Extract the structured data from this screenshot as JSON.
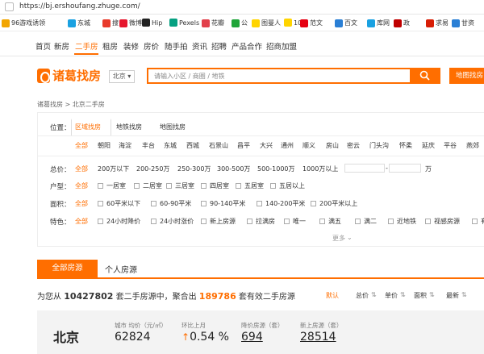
{
  "address": {
    "url": "https://bj.ershoufang.zhuge.com/"
  },
  "bookmarks": [
    {
      "label": "96游戏诱领",
      "color": "#f2a500"
    },
    {
      "label": "东城",
      "color": "#1aa1e1"
    },
    {
      "label": "搜",
      "color": "#e83a2b"
    },
    {
      "label": "微博",
      "color": "#e6162d"
    },
    {
      "label": "Hip",
      "color": "#222222"
    },
    {
      "label": "Pexels",
      "color": "#05a081"
    },
    {
      "label": "花瓣",
      "color": "#e2404b"
    },
    {
      "label": "公",
      "color": "#20a53a"
    },
    {
      "label": "图曼人",
      "color": "#ffd400"
    },
    {
      "label": "100",
      "color": "#ffd400"
    },
    {
      "label": "范文",
      "color": "#e60012"
    },
    {
      "label": "百文",
      "color": "#2a7fd5"
    },
    {
      "label": "库网",
      "color": "#1aa1e1"
    },
    {
      "label": "政",
      "color": "#c00000"
    },
    {
      "label": "求易",
      "color": "#d81e06"
    },
    {
      "label": "甘资",
      "color": "#2a7fd5"
    }
  ],
  "nav": [
    "首页",
    "新房",
    "二手房",
    "租房",
    "装修",
    "房价",
    "随手拍",
    "资讯",
    "招聘",
    "产品合作",
    "招商加盟"
  ],
  "header": {
    "logo": "诸葛找房",
    "city": "北京",
    "search_placeholder": "请输入小区 / 商圈 / 地铁",
    "map_button": "地图找房"
  },
  "breadcrumb": "诸葛找房 > 北京二手房",
  "filters": {
    "position_label": "位置：",
    "position_tabs": [
      "区域找房",
      "地铁找房",
      "地图找房"
    ],
    "areas": [
      "全部",
      "朝阳",
      "海淀",
      "丰台",
      "东城",
      "西城",
      "石景山",
      "昌平",
      "大兴",
      "通州",
      "顺义",
      "房山",
      "密云",
      "门头沟",
      "怀柔",
      "延庆",
      "平谷",
      "燕郊"
    ],
    "price_label": "总价：",
    "prices": [
      "全部",
      "200万以下",
      "200-250万",
      "250-300万",
      "300-500万",
      "500-1000万",
      "1000万以上"
    ],
    "price_unit": "万",
    "layout_label": "户型：",
    "layouts": [
      "全部",
      "一居室",
      "二居室",
      "三居室",
      "四居室",
      "五居室",
      "五居以上"
    ],
    "area_label": "面积：",
    "sizes": [
      "全部",
      "60平米以下",
      "60-90平米",
      "90-140平米",
      "140-200平米",
      "200平米以上"
    ],
    "feature_label": "特色：",
    "features": [
      "全部",
      "24小时降价",
      "24小时涨价",
      "新上房源",
      "拉满房",
      "唯一",
      "满五",
      "满二",
      "近地铁",
      "视感房源",
      "有"
    ],
    "more": "更多"
  },
  "tabs": {
    "all": "全部房源",
    "personal": "个人房源"
  },
  "summary": {
    "prefix": "为您从",
    "total": "10427802",
    "middle": "套二手房源中，聚合出",
    "valid": "189786",
    "suffix": "套有效二手房源"
  },
  "sort": [
    "默认",
    "总价",
    "单价",
    "面积",
    "最新"
  ],
  "stats": {
    "city": "北京",
    "items": [
      {
        "label": "城市 均价（元/㎡）",
        "value": "62824"
      },
      {
        "label": "环比上月",
        "value": "0.54 %"
      },
      {
        "label": "降价房源（套）",
        "value": "694"
      },
      {
        "label": "新上房源（套）",
        "value": "28514"
      }
    ]
  },
  "colors": {
    "accent": "#ff6e00"
  }
}
